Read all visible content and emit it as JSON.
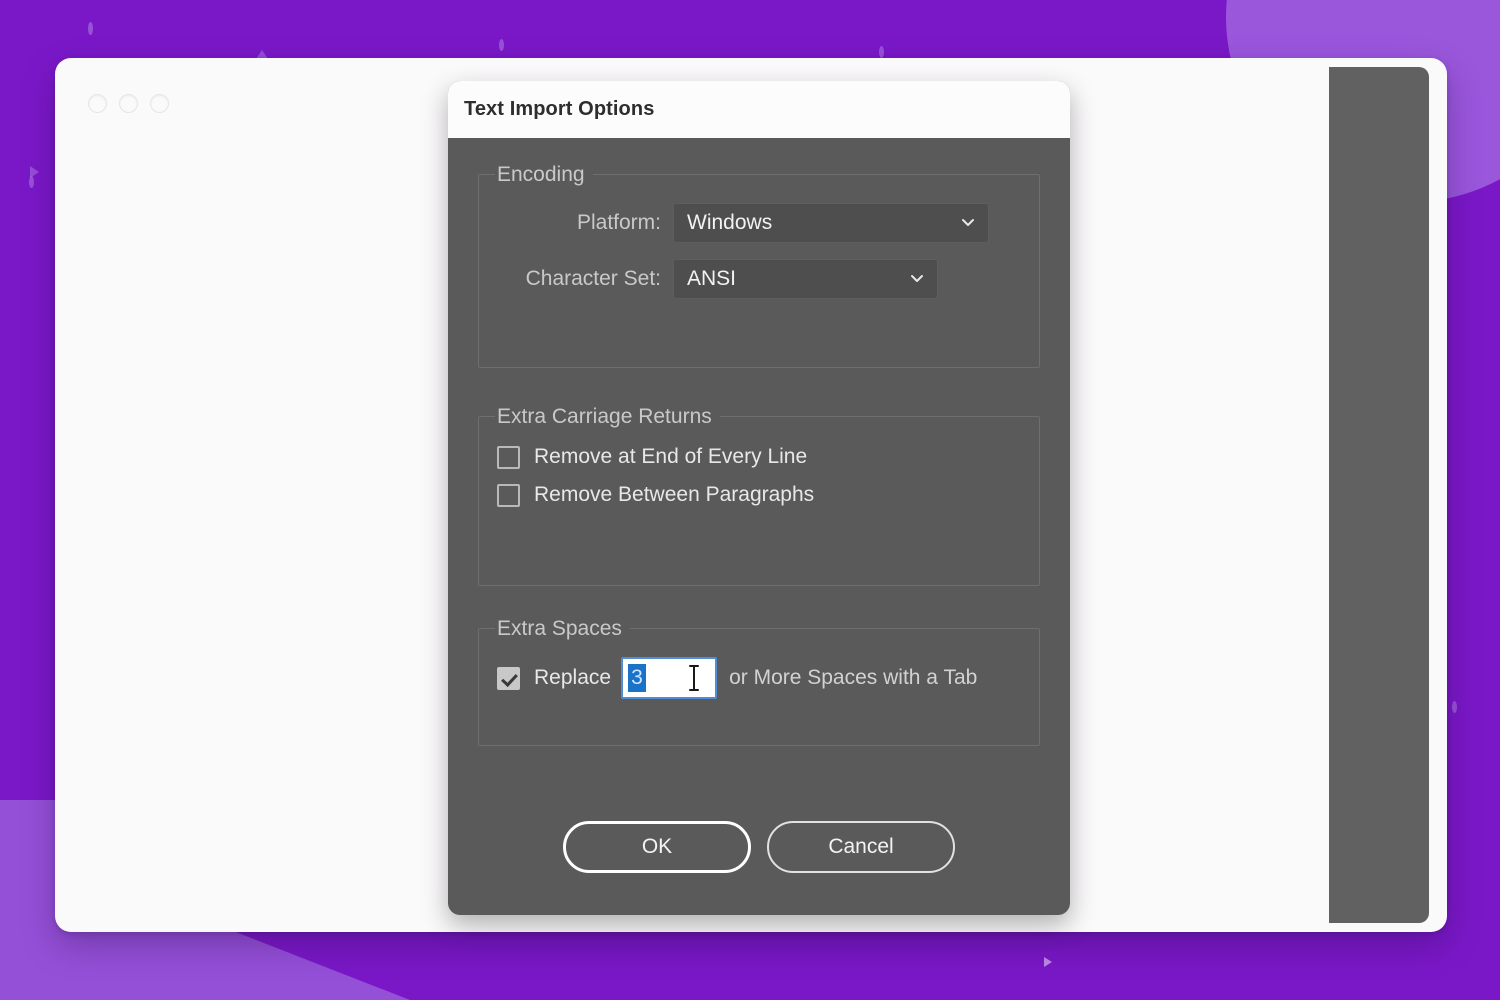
{
  "theme": {
    "background_purple": "#7a18c8",
    "accent_purple_light": "#9550d8",
    "dialog_gray": "#5a5a5a",
    "selection_blue": "#1a73c8",
    "focus_border_blue": "#4f8ed6"
  },
  "window": {
    "traffic_lights": [
      "close-dot",
      "minimize-dot",
      "maximize-dot"
    ]
  },
  "dialog": {
    "title": "Text Import Options",
    "groups": {
      "encoding": {
        "legend": "Encoding",
        "fields": [
          {
            "label": "Platform:",
            "value": "Windows"
          },
          {
            "label": "Character Set:",
            "value": "ANSI"
          }
        ]
      },
      "carriage_returns": {
        "legend": "Extra Carriage Returns",
        "checkboxes": [
          {
            "label": "Remove at End of Every Line",
            "checked": false
          },
          {
            "label": "Remove Between Paragraphs",
            "checked": false
          }
        ]
      },
      "extra_spaces": {
        "legend": "Extra Spaces",
        "checkbox": {
          "label": "Replace",
          "checked": true
        },
        "input_value": "3",
        "input_placeholder": "3",
        "suffix": "or More Spaces with a Tab"
      }
    },
    "buttons": {
      "ok": "OK",
      "cancel": "Cancel"
    }
  }
}
